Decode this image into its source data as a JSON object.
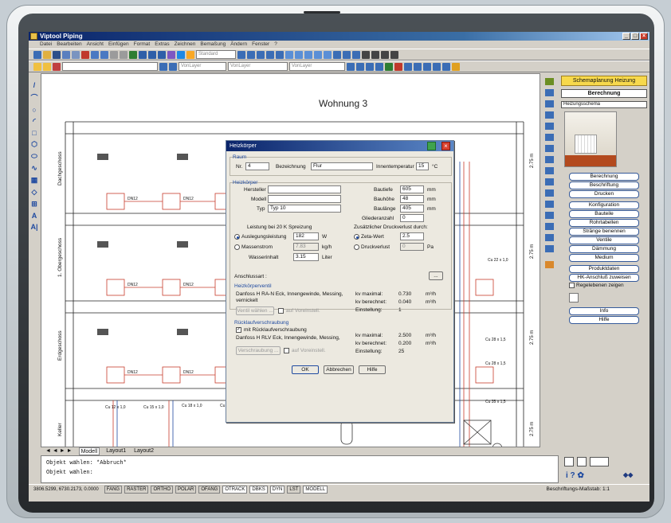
{
  "app": {
    "title": "Viptool Piping",
    "menu": [
      "Datei",
      "Bearbeiten",
      "Ansicht",
      "Einfügen",
      "Format",
      "Extras",
      "Zeichnen",
      "Bemaßung",
      "Ändern",
      "Fenster",
      "?"
    ],
    "style_combo": "Standard",
    "layer_combo": "VonLayer",
    "linetype_combo": "VonLayer",
    "lineweight_combo": "VonLayer"
  },
  "drawing": {
    "title": "Wohnung 3",
    "floors": [
      "Dachgeschoss",
      "1. Obergeschoss",
      "Erdgeschoss",
      "Keller"
    ],
    "room_labels": [
      "DN12",
      "DN12",
      "DN12",
      "DN12",
      "DN12",
      "DN12"
    ],
    "dims": [
      "2.75 m",
      "2.75 m",
      "2.75 m",
      "2.75 m"
    ],
    "pipe_labels": [
      "Cu 22 x 1,0",
      "Cu 28 x 1,5",
      "Cu 28 x 1,5",
      "Cu 35 x 1,5",
      "Cu 12 x 1,0",
      "Cu 15 x 1,0",
      "Cu 18 x 1,0",
      "Cu 15 x 1,0"
    ],
    "axis_label": "X",
    "tabs": [
      "Modell",
      "Layout1",
      "Layout2"
    ]
  },
  "dialog": {
    "title": "Heizkörper",
    "sect_raum": "Raum",
    "nr_label": "Nr.",
    "nr_value": "4",
    "bez_label": "Bezeichnung",
    "bez_value": "Flur",
    "innentemp_label": "Innentemperatur",
    "innentemp_value": "15",
    "innentemp_unit": "°C",
    "sect_heizkoerper": "Heizkörper",
    "hersteller_label": "Hersteller",
    "modell_label": "Modell",
    "typ_label": "Typ",
    "typ_value": "Typ 10",
    "bautiefe_label": "Bautiefe",
    "bautiefe_value": "605",
    "bautiefe_unit": "mm",
    "bauhoehe_label": "Bauhöhe",
    "bauhoehe_value": "48",
    "bauhoehe_unit": "mm",
    "baulaenge_label": "Baulänge",
    "baulaenge_value": "405",
    "baulaenge_unit": "mm",
    "glieder_label": "Gliederanzahl",
    "glieder_value": "0",
    "leistung_label": "Leistung bei 20 K Spreizung",
    "ausleg_label": "Auslegungsleistung",
    "ausleg_value": "182",
    "ausleg_unit": "W",
    "massen_label": "Massenstrom",
    "massen_value": "7.83",
    "massen_unit": "kg/h",
    "wasser_label": "Wasserinhalt",
    "wasser_value": "3.15",
    "wasser_unit": "Liter",
    "zusatz_label": "Zusätzlicher Druckverlust durch:",
    "zeta_label": "Zeta-Wert",
    "zeta_value": "2.5",
    "druck_label": "Druckverlust",
    "druck_value": "0",
    "druck_unit": "Pa",
    "anschluss_label": "Anschlussart :",
    "anschluss_btn": "...",
    "sect_ventil": "Heizkörperventil",
    "ventil_text1": "Danfoss H RA-N Eck, Innengewinde, Messing,",
    "ventil_text2": "vernickelt",
    "kv_max_label": "kv maximal:",
    "kv_max_value": "0.730",
    "kv_max_unit": "m³/h",
    "kv_ber_label": "kv berechnet:",
    "kv_ber_value": "0.040",
    "kv_ber_unit": "m³/h",
    "einst_label": "Einstellung:",
    "einst_value": "1",
    "ventil_btn": "Ventil wählen ...",
    "voreinst_label": "auf Voreinstell.",
    "sect_rueck": "Rücklaufverschraubung",
    "rueck_check": "mit Rücklaufverschraubung",
    "rueck_text": "Danfoss H RLV Eck, Innengewinde, Messing,",
    "kv_max2_value": "2.500",
    "kv_ber2_value": "0.200",
    "einst2_value": "25",
    "versch_btn": "Verschraubung ...",
    "ok_btn": "OK",
    "cancel_btn": "Abbrechen",
    "help_btn": "Hilfe"
  },
  "panel": {
    "header": "Schemaplanung Heizung",
    "selector": "Berechnung",
    "list_label": "Heizungsschema",
    "buttons": [
      "Berechnung",
      "Beschriftung",
      "Drucken",
      "Konfiguration",
      "Bauteile",
      "Rohrtabellen",
      "Stränge benennen",
      "Ventile",
      "Dämmung",
      "Medium",
      "Produktdaten",
      "HK-Anschluß zuweisen"
    ],
    "check_label": "Regelebenen zeigen",
    "info_btn": "Info",
    "help_btn": "Hilfe"
  },
  "command": {
    "line1": "Objekt wählen: *Abbruch*",
    "line2": "Objekt wählen:"
  },
  "status": {
    "coords": "3806.5299, 6730.2173, 0.0000",
    "toggles": [
      "FANG",
      "RASTER",
      "ORTHO",
      "POLAR",
      "OFANG",
      "OTRACK",
      "DBKS",
      "DYN",
      "LST",
      "MODELL"
    ],
    "scale": "Beschriftungs-Maßstab: 1:1"
  }
}
